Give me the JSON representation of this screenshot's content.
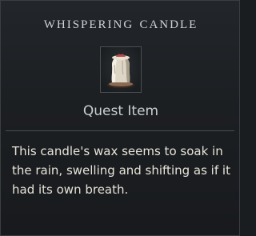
{
  "item": {
    "name": "Whispering Candle",
    "category": "Quest Item",
    "description": "This candle's wax seems to soak in the rain, swelling and shifting as if it had its own breath.",
    "icon": "melted-candle-icon"
  },
  "colors": {
    "panel_bg": "#1c1f22",
    "title_text": "#cfd3d6",
    "description_text": "#e6e3d8",
    "border": "#3a3e42"
  }
}
